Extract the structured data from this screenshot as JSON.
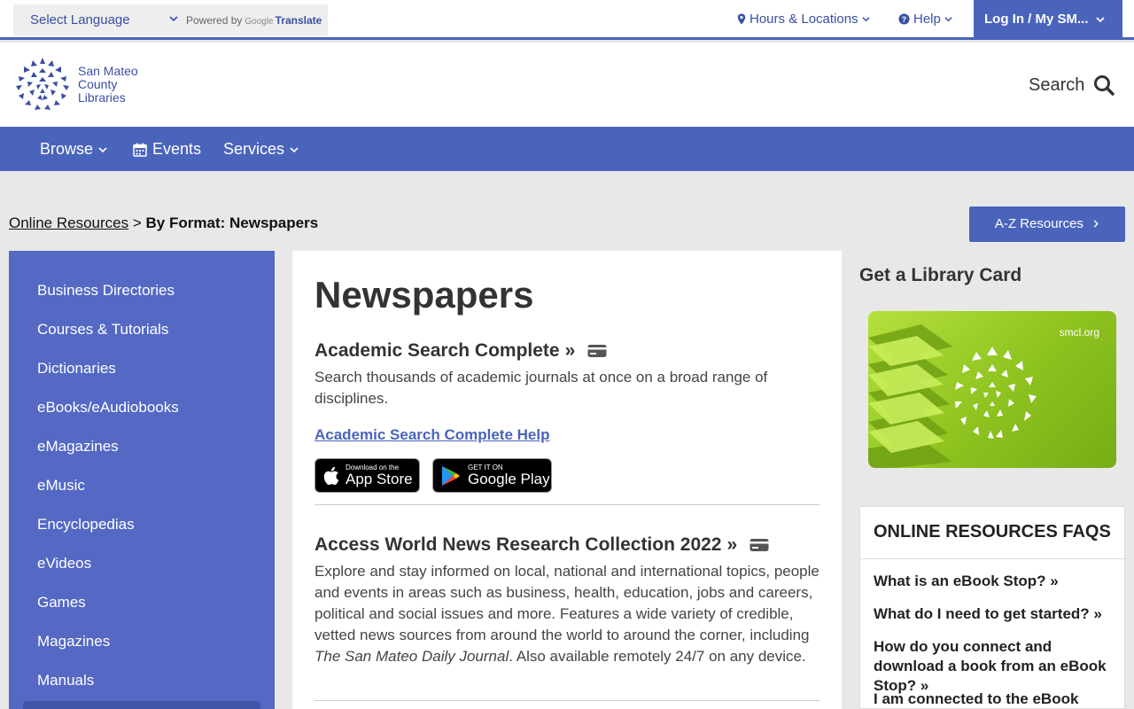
{
  "topbar": {
    "language_select": "Select Language",
    "powered_by": "Powered by",
    "google": "Google",
    "translate": "Translate",
    "hours": "Hours & Locations",
    "help": "Help",
    "login": "Log In / My SM..."
  },
  "header": {
    "logo_lines": [
      "San Mateo",
      "County",
      "Libraries"
    ],
    "search_label": "Search"
  },
  "nav": {
    "browse": "Browse",
    "events": "Events",
    "services": "Services"
  },
  "breadcrumb": {
    "parent": "Online Resources",
    "separator": ">",
    "current": "By Format: Newspapers"
  },
  "az_button": "A-Z Resources",
  "sidebar": {
    "items": [
      "Business Directories",
      "Courses & Tutorials",
      "Dictionaries",
      "eBooks/eAudiobooks",
      "eMagazines",
      "eMusic",
      "Encyclopedias",
      "eVideos",
      "Games",
      "Magazines",
      "Manuals"
    ]
  },
  "main": {
    "title": "Newspapers",
    "resources": [
      {
        "title": "Academic Search Complete",
        "description": "Search thousands of academic journals at once on a broad range of disciplines.",
        "help_link": "Academic Search Complete Help",
        "app_store_small": "Download on the",
        "app_store_big": "App Store",
        "google_play_small": "GET IT ON",
        "google_play_big": "Google Play"
      },
      {
        "title": "Access World News Research Collection 2022",
        "description_before": "Explore and stay informed on local, national and international topics, people and events in areas such as business, health, education, jobs and careers, political and social issues and more. Features a wide variety of credible, vetted news sources from around the world to around the corner, including ",
        "description_italic": "The San Mateo Daily Journal",
        "description_after": ". Also available remotely 24/7 on any device."
      }
    ]
  },
  "right": {
    "card_heading": "Get a Library Card",
    "card_url": "smcl.org",
    "faq_title": "ONLINE RESOURCES FAQS",
    "faqs": [
      "What is an eBook Stop?",
      "What do I need to get started?",
      "How do you connect and download a book from an eBook Stop?",
      "I am connected to the eBook Stop"
    ]
  },
  "colors": {
    "brand_blue": "#4a64bb",
    "sidebar_blue": "#5468c4",
    "card_green": "#8dc21f"
  }
}
